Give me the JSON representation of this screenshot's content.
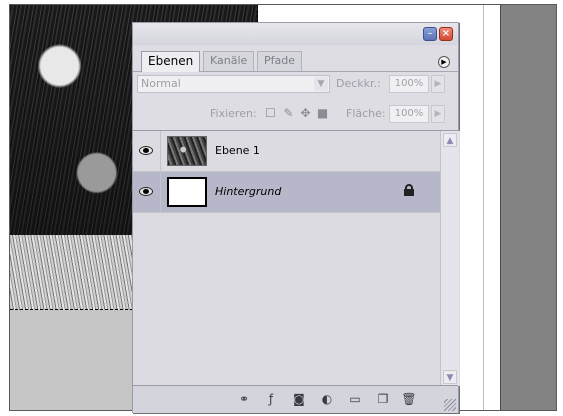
{
  "palette": {
    "tabs": [
      {
        "label": "Ebenen",
        "active": true
      },
      {
        "label": "Kanäle",
        "active": false
      },
      {
        "label": "Pfade",
        "active": false
      }
    ],
    "blend_mode": "Normal",
    "opacity_label": "Deckkr.:",
    "opacity_value": "100%",
    "lock_label": "Fixieren:",
    "fill_label": "Fläche:",
    "fill_value": "100%",
    "layers": [
      {
        "name": "Ebene 1",
        "visible": true,
        "selected": false,
        "locked": false,
        "thumbnail": "photo"
      },
      {
        "name": "Hintergrund",
        "visible": true,
        "selected": true,
        "locked": true,
        "thumbnail": "white"
      }
    ]
  },
  "icons": {
    "eye": "eye-icon",
    "padlock": "padlock-icon",
    "link": "link-icon",
    "fx": "fx-icon",
    "mask": "mask-icon",
    "adjustment": "adjustment-icon",
    "folder": "folder-icon",
    "new_layer": "new-layer-icon",
    "trash": "trash-icon"
  },
  "colors": {
    "selected_row": "#b6b8c9",
    "panel_bg": "#dedde4",
    "close_button": "#d34a33",
    "minimize_button": "#5a72b8"
  }
}
